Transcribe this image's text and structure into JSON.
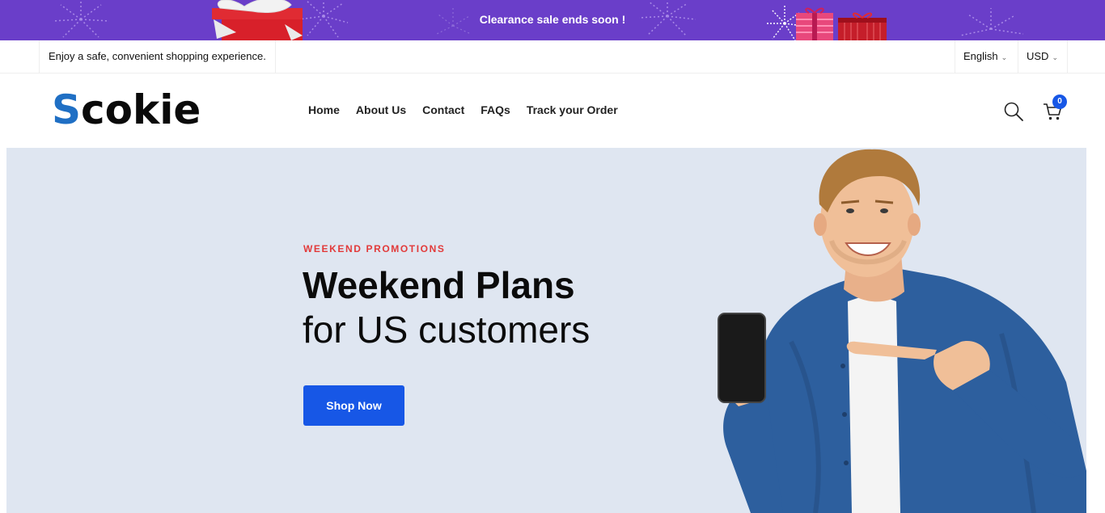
{
  "promo_banner": {
    "text": "Clearance sale ends soon !"
  },
  "topbar": {
    "tagline": "Enjoy a safe, convenient shopping experience.",
    "language": "English",
    "currency": "USD"
  },
  "header": {
    "logo_first": "S",
    "logo_rest": "cokie",
    "nav": [
      "Home",
      "About Us",
      "Contact",
      "FAQs",
      "Track your Order"
    ],
    "cart_count": "0"
  },
  "hero": {
    "eyebrow": "WEEKEND PROMOTIONS",
    "title": "Weekend Plans",
    "subtitle": "for US customers",
    "cta": "Shop Now"
  },
  "colors": {
    "promo_bg": "#6a3ec9",
    "accent": "#1757e6",
    "eyebrow": "#e23a3a",
    "hero_bg": "#dfe6f1",
    "logo_s": "#1f6fc4"
  },
  "icons": [
    "search-icon",
    "cart-icon",
    "chevron-down-icon",
    "gift-icon",
    "firework-icon"
  ]
}
